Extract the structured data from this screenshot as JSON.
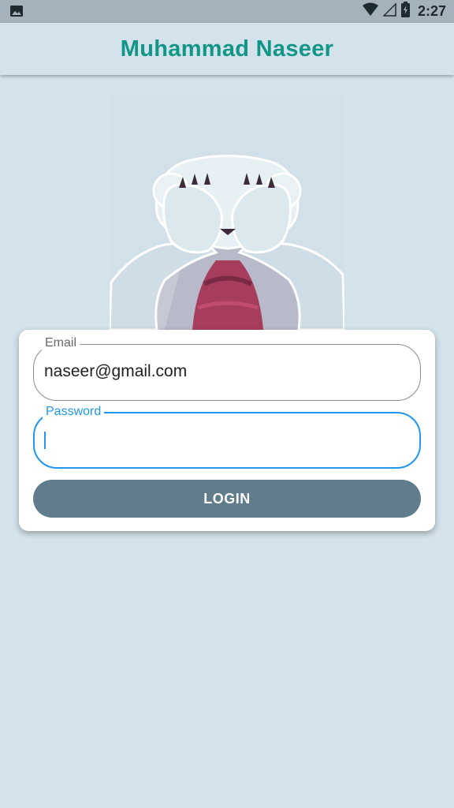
{
  "status_bar": {
    "time": "2:27",
    "icons": [
      "image-icon",
      "wifi-icon",
      "signal-icon",
      "battery-icon"
    ]
  },
  "app_bar": {
    "title": "Muhammad Naseer",
    "title_color": "#129688"
  },
  "mascot": {
    "icon": "bear-covering-eyes-illustration"
  },
  "login_form": {
    "email": {
      "label": "Email",
      "value": "naseer@gmail.com"
    },
    "password": {
      "label": "Password",
      "value": ""
    },
    "login_label": "LOGIN"
  },
  "colors": {
    "background": "#d4e2eb",
    "accent": "#2196f3",
    "button": "#617d8b"
  }
}
